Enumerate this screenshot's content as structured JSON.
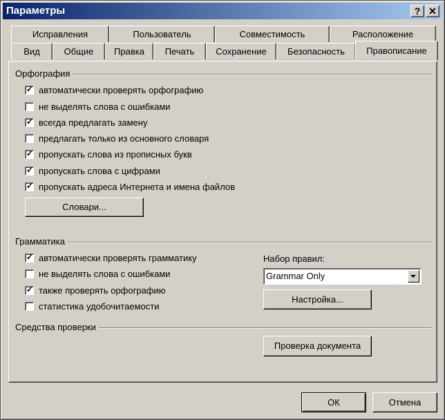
{
  "window": {
    "title": "Параметры",
    "help_btn": "?",
    "close_btn": "✕"
  },
  "tabs_back": [
    "Исправления",
    "Пользователь",
    "Совместимость",
    "Расположение"
  ],
  "tabs_front": [
    "Вид",
    "Общие",
    "Правка",
    "Печать",
    "Сохранение",
    "Безопасность",
    "Правописание"
  ],
  "active_tab": "Правописание",
  "spelling": {
    "group_label": "Орфография",
    "options": [
      {
        "label": "автоматически проверять орфографию",
        "checked": true
      },
      {
        "label": "не выделять слова с ошибками",
        "checked": false
      },
      {
        "label": "всегда предлагать замену",
        "checked": true
      },
      {
        "label": "предлагать только из основного словаря",
        "checked": false
      },
      {
        "label": "пропускать слова из прописных букв",
        "checked": true
      },
      {
        "label": "пропускать слова с цифрами",
        "checked": true
      },
      {
        "label": "пропускать адреса Интернета и имена файлов",
        "checked": true
      }
    ],
    "dictionaries_button": "Словари..."
  },
  "grammar": {
    "group_label": "Грамматика",
    "options": [
      {
        "label": "автоматически проверять грамматику",
        "checked": true
      },
      {
        "label": "не выделять слова с ошибками",
        "checked": false
      },
      {
        "label": "также проверять орфографию",
        "checked": true
      },
      {
        "label": "статистика удобочитаемости",
        "checked": false
      }
    ],
    "ruleset_label": "Набор правил:",
    "ruleset_value": "Grammar Only",
    "settings_button": "Настройка..."
  },
  "proofing": {
    "group_label": "Средства проверки",
    "check_document_button": "Проверка документа"
  },
  "footer": {
    "ok_button": "ОК",
    "cancel_button": "Отмена"
  }
}
